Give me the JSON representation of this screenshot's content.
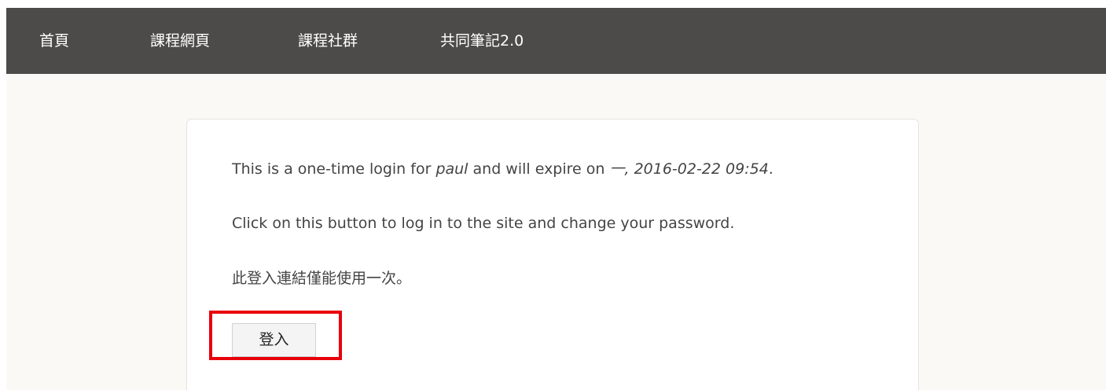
{
  "navbar": {
    "items": [
      {
        "label": "首頁"
      },
      {
        "label": "課程網頁"
      },
      {
        "label": "課程社群"
      },
      {
        "label": "共同筆記2.0"
      }
    ]
  },
  "message": {
    "line1_prefix": "This is a one-time login for ",
    "username": "paul",
    "line1_middle": " and will expire on ",
    "expiry": "一, 2016-02-22 09:54",
    "line1_suffix": ".",
    "line2": "Click on this button to log in to the site and change your password.",
    "line3": "此登入連結僅能使用一次。"
  },
  "login_button": {
    "label": "登入"
  },
  "colors": {
    "navbar_bg": "#4d4b49",
    "page_bg": "#faf9f6",
    "highlight": "#e8000b"
  }
}
